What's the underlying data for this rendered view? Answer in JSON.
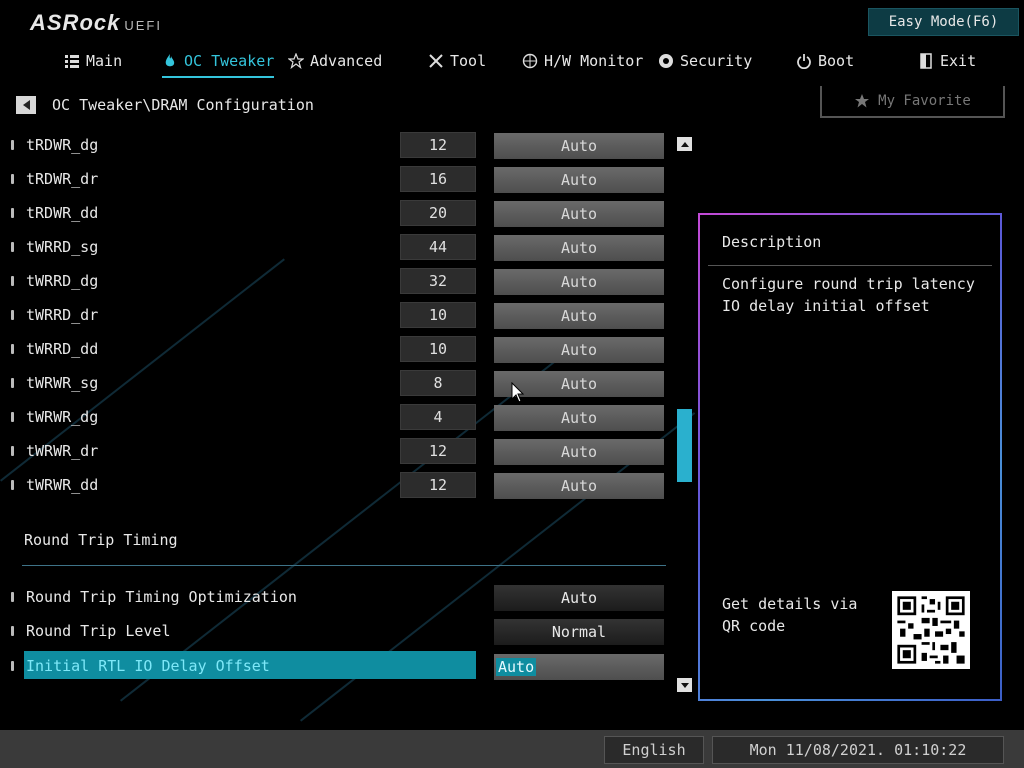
{
  "header": {
    "brand": "ASRock",
    "brand_suffix": "UEFI",
    "easy_mode_label": "Easy Mode(F6)",
    "favorite_label": "My Favorite"
  },
  "nav": {
    "tabs": [
      {
        "label": "Main",
        "icon": "list-icon",
        "active": false
      },
      {
        "label": "OC Tweaker",
        "icon": "flame-icon",
        "active": true
      },
      {
        "label": "Advanced",
        "icon": "star-icon",
        "active": false
      },
      {
        "label": "Tool",
        "icon": "tools-icon",
        "active": false
      },
      {
        "label": "H/W Monitor",
        "icon": "monitor-icon",
        "active": false
      },
      {
        "label": "Security",
        "icon": "shield-icon",
        "active": false
      },
      {
        "label": "Boot",
        "icon": "power-icon",
        "active": false
      },
      {
        "label": "Exit",
        "icon": "exit-icon",
        "active": false
      }
    ]
  },
  "breadcrumb": "OC Tweaker\\DRAM Configuration",
  "settings": [
    {
      "label": "tRDWR_dg",
      "current": "12",
      "option": "Auto"
    },
    {
      "label": "tRDWR_dr",
      "current": "16",
      "option": "Auto"
    },
    {
      "label": "tRDWR_dd",
      "current": "20",
      "option": "Auto"
    },
    {
      "label": "tWRRD_sg",
      "current": "44",
      "option": "Auto"
    },
    {
      "label": "tWRRD_dg",
      "current": "32",
      "option": "Auto"
    },
    {
      "label": "tWRRD_dr",
      "current": "10",
      "option": "Auto"
    },
    {
      "label": "tWRRD_dd",
      "current": "10",
      "option": "Auto"
    },
    {
      "label": "tWRWR_sg",
      "current": "8",
      "option": "Auto"
    },
    {
      "label": "tWRWR_dg",
      "current": "4",
      "option": "Auto"
    },
    {
      "label": "tWRWR_dr",
      "current": "12",
      "option": "Auto"
    },
    {
      "label": "tWRWR_dd",
      "current": "12",
      "option": "Auto"
    }
  ],
  "round_trip": {
    "section_title": "Round Trip Timing",
    "items": [
      {
        "label": "Round Trip Timing Optimization",
        "option": "Auto"
      },
      {
        "label": "Round Trip Level",
        "option": "Normal"
      },
      {
        "label": "Initial RTL IO Delay Offset",
        "option": "Auto",
        "selected": true
      }
    ]
  },
  "scrollbar": {
    "position": 0.57,
    "visible_fraction": 0.14
  },
  "description": {
    "title": "Description",
    "text": "Configure round trip latency IO delay initial offset",
    "qr_text": "Get details via QR code"
  },
  "footer": {
    "language": "English",
    "datetime": "Mon 11/08/2021. 01:10:22"
  },
  "colors": {
    "accent": "#34c5dc",
    "selected_bg": "#0f8da0"
  }
}
